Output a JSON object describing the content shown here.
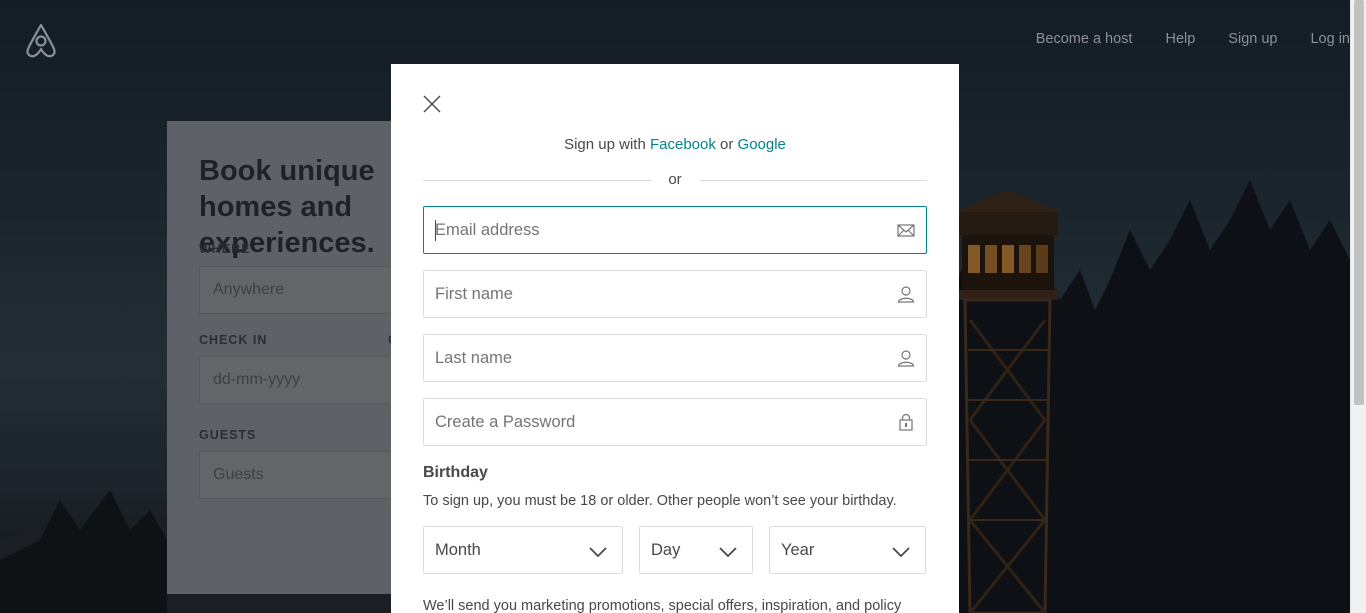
{
  "header": {
    "nav": [
      "Become a host",
      "Help",
      "Sign up",
      "Log in"
    ]
  },
  "search_card": {
    "headline": "Book unique homes and experiences.",
    "where_label": "WHERE",
    "where_placeholder": "Anywhere",
    "checkin_label": "CHECK IN",
    "checkout_label": "C",
    "checkin_placeholder": "dd-mm-yyyy",
    "guests_label": "GUESTS",
    "guests_placeholder": "Guests"
  },
  "modal": {
    "social_prefix": "Sign up with",
    "facebook": "Facebook",
    "social_or": "or",
    "google": "Google",
    "divider": "or",
    "email_placeholder": "Email address",
    "first_name_placeholder": "First name",
    "last_name_placeholder": "Last name",
    "password_placeholder": "Create a Password",
    "birthday_title": "Birthday",
    "birthday_note": "To sign up, you must be 18 or older. Other people won’t see your birthday.",
    "month": "Month",
    "day": "Day",
    "year": "Year",
    "marketing_note": "We’ll send you marketing promotions, special offers, inspiration, and policy"
  },
  "colors": {
    "accent": "#008489",
    "focus_border": "#008489"
  }
}
